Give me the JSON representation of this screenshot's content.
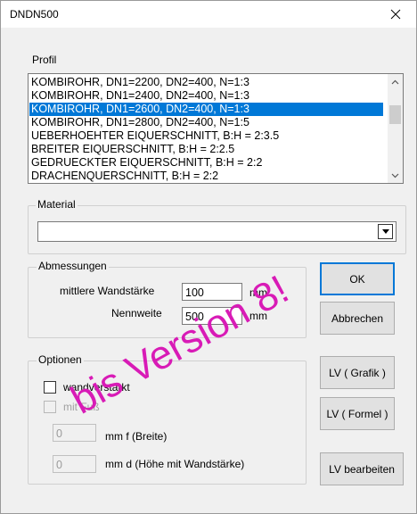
{
  "window": {
    "title": "DNDN500"
  },
  "profil": {
    "label": "Profil",
    "items": [
      "KOMBIROHR, DN1=2200,  DN2=400,  N=1:3",
      "KOMBIROHR, DN1=2400,  DN2=400,  N=1:3",
      "KOMBIROHR, DN1=2600,  DN2=400,  N=1:3",
      "KOMBIROHR, DN1=2800,  DN2=400,  N=1:5",
      "UEBERHOEHTER EIQUERSCHNITT, B:H = 2:3.5",
      "BREITER EIQUERSCHNITT,  B:H = 2:2.5",
      "GEDRUECKTER EIQUERSCHNITT,  B:H = 2:2",
      "DRACHENQUERSCHNITT,  B:H = 2:2"
    ],
    "selected_index": 2
  },
  "material": {
    "label": "Material",
    "value": ""
  },
  "abmessungen": {
    "label": "Abmessungen",
    "wandstaerke_label": "mittlere Wandstärke",
    "wandstaerke_value": "100",
    "wandstaerke_unit": "mm",
    "nennweite_label": "Nennweite",
    "nennweite_value": "500",
    "nennweite_unit": "mm"
  },
  "optionen": {
    "label": "Optionen",
    "wandverstaerkt_label": "wandverstärkt",
    "mitfuss_label": "mit Fuß",
    "breite_value": "0",
    "breite_label": "mm  f  (Breite)",
    "hoehe_value": "0",
    "hoehe_label": "mm  d (Höhe mit Wandstärke)"
  },
  "buttons": {
    "ok": "OK",
    "abbrechen": "Abbrechen",
    "lv_grafik": "LV ( Grafik )",
    "lv_formel": "LV ( Formel )",
    "lv_bearbeiten": "LV bearbeiten"
  },
  "watermark": "bis Version 8!",
  "colors": {
    "selection": "#0078d7",
    "watermark": "#d81bb6"
  }
}
